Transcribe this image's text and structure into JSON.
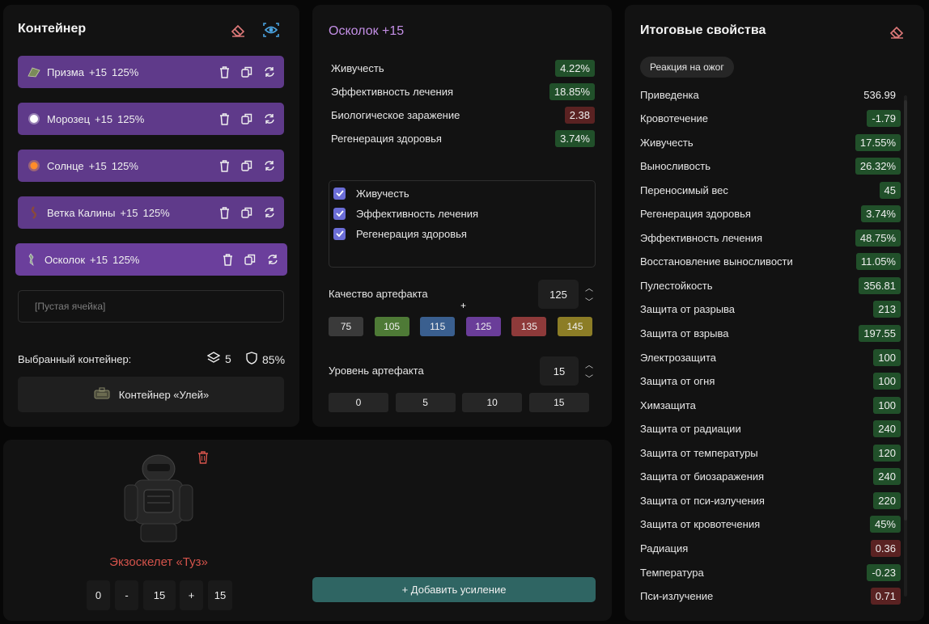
{
  "container_panel": {
    "title": "Контейнер",
    "artifacts": [
      {
        "name": "Призма",
        "level": "+15",
        "quality": "125%",
        "icon": "prism-icon"
      },
      {
        "name": "Морозец",
        "level": "+15",
        "quality": "125%",
        "icon": "frost-orb-icon"
      },
      {
        "name": "Солнце",
        "level": "+15",
        "quality": "125%",
        "icon": "sun-orb-icon"
      },
      {
        "name": "Ветка Калины",
        "level": "+15",
        "quality": "125%",
        "icon": "viburnum-branch-icon"
      },
      {
        "name": "Осколок",
        "level": "+15",
        "quality": "125%",
        "icon": "shard-icon"
      }
    ],
    "empty_slot": "[Пустая ячейка]",
    "selected_label": "Выбранный контейнер:",
    "slots_count": "5",
    "protection": "85%",
    "container_name": "Контейнер «Улей»"
  },
  "artifact_panel": {
    "title": "Осколок +15",
    "stats": [
      {
        "name": "Живучесть",
        "value": "4.22%",
        "sign": "pos"
      },
      {
        "name": "Эффективность лечения",
        "value": "18.85%",
        "sign": "pos"
      },
      {
        "name": "Биологическое заражение",
        "value": "2.38",
        "sign": "neg"
      },
      {
        "name": "Регенерация здоровья",
        "value": "3.74%",
        "sign": "pos"
      }
    ],
    "checks": [
      {
        "label": "Живучесть",
        "checked": true
      },
      {
        "label": "Эффективность лечения",
        "checked": true
      },
      {
        "label": "Регенерация здоровья",
        "checked": true
      }
    ],
    "quality_label": "Качество артефакта",
    "quality_value": "125",
    "quality_presets": [
      {
        "label": "75",
        "color": "#3a3a3a"
      },
      {
        "label": "105",
        "color": "#4e7a36"
      },
      {
        "label": "115",
        "color": "#3a5f8f"
      },
      {
        "label": "125",
        "color": "#6a3d99"
      },
      {
        "label": "135",
        "color": "#8e3a3a"
      },
      {
        "label": "145",
        "color": "#8c7d26"
      }
    ],
    "level_label": "Уровень артефакта",
    "level_value": "15",
    "level_presets": [
      "0",
      "5",
      "10",
      "15"
    ]
  },
  "armor_panel": {
    "name": "Экзоскелет «Туз»",
    "stepper": {
      "min": "0",
      "minus": "-",
      "value": "15",
      "plus": "+",
      "max": "15"
    },
    "add_button": "+ Добавить усиление"
  },
  "totals_panel": {
    "title": "Итоговые свойства",
    "filter_pill": "Реакция на ожог",
    "props": [
      {
        "name": "Приведенка",
        "value": "536.99",
        "sign": "plain"
      },
      {
        "name": "Кровотечение",
        "value": "-1.79",
        "sign": "pos"
      },
      {
        "name": "Живучесть",
        "value": "17.55%",
        "sign": "pos"
      },
      {
        "name": "Выносливость",
        "value": "26.32%",
        "sign": "pos"
      },
      {
        "name": "Переносимый вес",
        "value": "45",
        "sign": "pos"
      },
      {
        "name": "Регенерация здоровья",
        "value": "3.74%",
        "sign": "pos"
      },
      {
        "name": "Эффективность лечения",
        "value": "48.75%",
        "sign": "pos"
      },
      {
        "name": "Восстановление выносливости",
        "value": "11.05%",
        "sign": "pos"
      },
      {
        "name": "Пулестойкость",
        "value": "356.81",
        "sign": "pos"
      },
      {
        "name": "Защита от разрыва",
        "value": "213",
        "sign": "pos"
      },
      {
        "name": "Защита от взрыва",
        "value": "197.55",
        "sign": "pos"
      },
      {
        "name": "Электрозащита",
        "value": "100",
        "sign": "pos"
      },
      {
        "name": "Защита от огня",
        "value": "100",
        "sign": "pos"
      },
      {
        "name": "Химзащита",
        "value": "100",
        "sign": "pos"
      },
      {
        "name": "Защита от радиации",
        "value": "240",
        "sign": "pos"
      },
      {
        "name": "Защита от температуры",
        "value": "120",
        "sign": "pos"
      },
      {
        "name": "Защита от биозаражения",
        "value": "240",
        "sign": "pos"
      },
      {
        "name": "Защита от пси-излучения",
        "value": "220",
        "sign": "pos"
      },
      {
        "name": "Защита от кровотечения",
        "value": "45%",
        "sign": "pos"
      },
      {
        "name": "Радиация",
        "value": "0.36",
        "sign": "neg"
      },
      {
        "name": "Температура",
        "value": "-0.23",
        "sign": "pos"
      },
      {
        "name": "Пси-излучение",
        "value": "0.71",
        "sign": "neg"
      }
    ]
  },
  "colors": {
    "accent_purple": "#6b3f9c",
    "positive": "#21502a",
    "negative": "#5a2222",
    "title_violet": "#c48fe6",
    "danger": "#d4534b"
  }
}
